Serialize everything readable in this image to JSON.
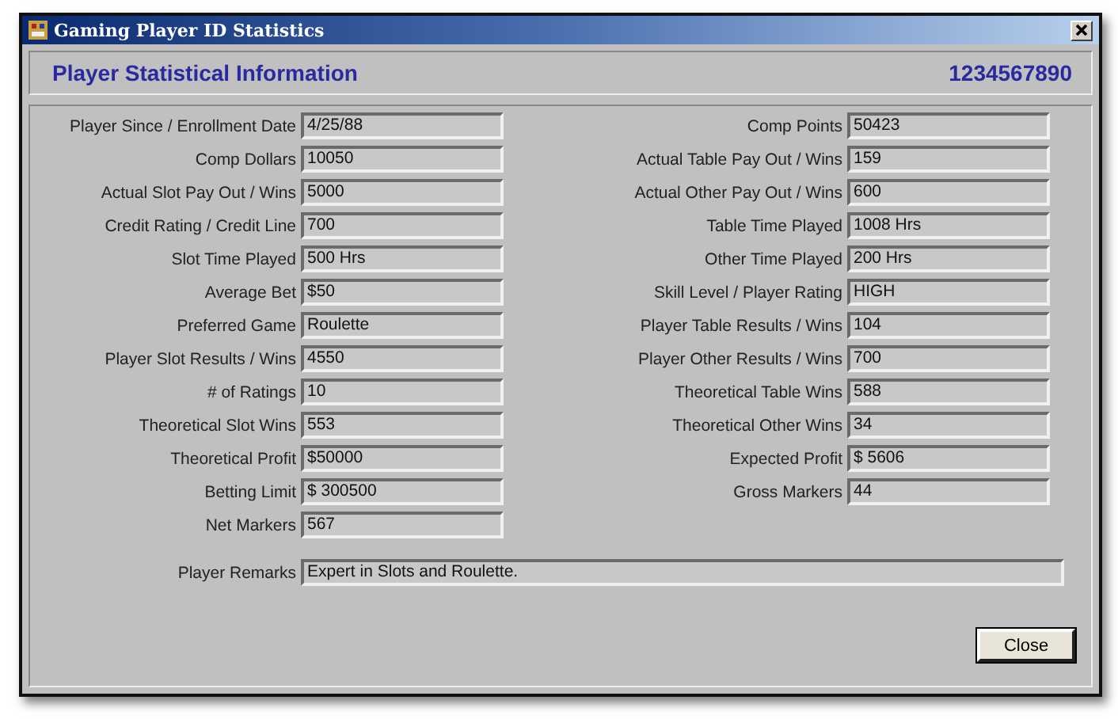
{
  "window": {
    "title": "Gaming Player ID Statistics"
  },
  "header": {
    "title": "Player Statistical Information",
    "player_id": "1234567890"
  },
  "left_fields": [
    {
      "label": "Player Since / Enrollment Date",
      "value": "4/25/88"
    },
    {
      "label": "Comp Dollars",
      "value": "10050"
    },
    {
      "label": "Actual Slot Pay Out / Wins",
      "value": "5000"
    },
    {
      "label": "Credit Rating / Credit Line",
      "value": "700"
    },
    {
      "label": "Slot Time Played",
      "value": "500 Hrs"
    },
    {
      "label": "Average Bet",
      "value": "$50"
    },
    {
      "label": "Preferred Game",
      "value": "Roulette"
    },
    {
      "label": "Player Slot Results / Wins",
      "value": "4550"
    },
    {
      "label": "# of Ratings",
      "value": "10"
    },
    {
      "label": "Theoretical Slot Wins",
      "value": "553"
    },
    {
      "label": "Theoretical Profit",
      "value": "$50000"
    },
    {
      "label": "Betting Limit",
      "value": "$ 300500"
    },
    {
      "label": "Net Markers",
      "value": "567"
    }
  ],
  "right_fields": [
    {
      "label": "Comp Points",
      "value": "50423"
    },
    {
      "label": "Actual Table Pay Out / Wins",
      "value": "159"
    },
    {
      "label": "Actual Other Pay Out / Wins",
      "value": "600"
    },
    {
      "label": "Table Time Played",
      "value": "1008 Hrs"
    },
    {
      "label": "Other Time Played",
      "value": "200 Hrs"
    },
    {
      "label": "Skill Level / Player Rating",
      "value": "HIGH"
    },
    {
      "label": "Player Table Results / Wins",
      "value": "104"
    },
    {
      "label": "Player Other Results / Wins",
      "value": "700"
    },
    {
      "label": "Theoretical Table Wins",
      "value": "588"
    },
    {
      "label": "Theoretical Other Wins",
      "value": "34"
    },
    {
      "label": "Expected Profit",
      "value": "$ 5606"
    },
    {
      "label": "Gross Markers",
      "value": "44"
    }
  ],
  "remarks": {
    "label": "Player Remarks",
    "value": "Expert in Slots and Roulette."
  },
  "buttons": [
    "Close"
  ]
}
